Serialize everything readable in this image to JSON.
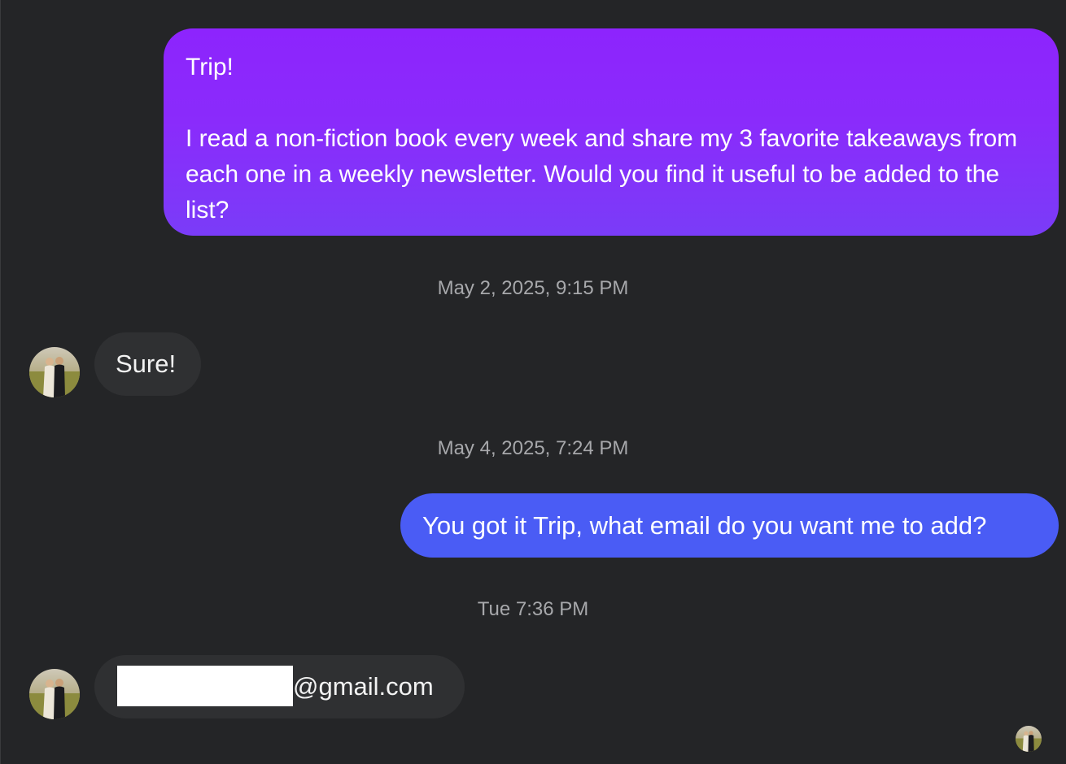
{
  "messages": {
    "outgoing_1": "Trip!\n\nI read a non-fiction book every week and share my 3 favorite takeaways from each one in a weekly newsletter. Would you find it useful to be added to the list?",
    "timestamp_1": "May 2, 2025, 9:15 PM",
    "incoming_1": "Sure!",
    "timestamp_2": "May 4, 2025, 7:24 PM",
    "outgoing_2": "You got it Trip, what email do you want me to add?",
    "timestamp_3": "Tue 7:36 PM",
    "incoming_2_suffix": "@gmail.com"
  },
  "colors": {
    "background": "#242527",
    "outgoing_purple": "#8a2bfb",
    "outgoing_blue": "#4a5cf5",
    "incoming_bubble": "#2f3032",
    "timestamp_text": "#a7a8ab",
    "redaction": "#ffffff"
  },
  "icons": {
    "contact_avatar": "avatar-photo-icon",
    "read_receipt": "read-receipt-avatar-icon"
  }
}
